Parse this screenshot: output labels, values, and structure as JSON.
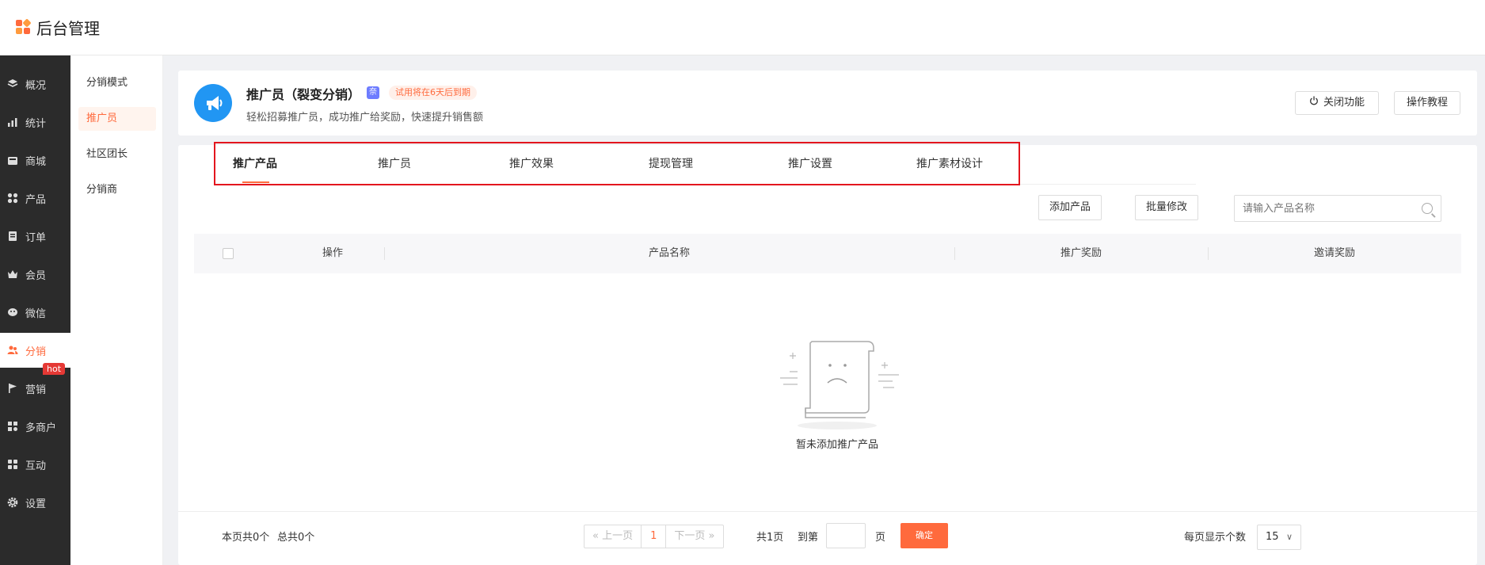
{
  "app": {
    "title": "后台管理"
  },
  "nav": {
    "items": [
      {
        "label": "概况",
        "icon": "layers-icon"
      },
      {
        "label": "统计",
        "icon": "chart-icon"
      },
      {
        "label": "商城",
        "icon": "shop-icon"
      },
      {
        "label": "产品",
        "icon": "grid-icon"
      },
      {
        "label": "订单",
        "icon": "order-icon"
      },
      {
        "label": "会员",
        "icon": "crown-icon"
      },
      {
        "label": "微信",
        "icon": "wechat-icon"
      },
      {
        "label": "分销",
        "icon": "users-icon",
        "active": true
      },
      {
        "label": "营销",
        "icon": "flag-icon",
        "badge": "hot"
      },
      {
        "label": "多商户",
        "icon": "store-icon"
      },
      {
        "label": "互动",
        "icon": "interact-icon"
      },
      {
        "label": "设置",
        "icon": "gear-icon"
      }
    ]
  },
  "subnav": {
    "items": [
      "分销模式",
      "推广员",
      "社区团长",
      "分销商"
    ],
    "active": "推广员"
  },
  "header": {
    "title": "推广员（裂变分销）",
    "badge": "奈",
    "trial": "试用将在6天后到期",
    "desc": "轻松招募推广员，成功推广给奖励，快速提升销售额",
    "close_label": "关闭功能",
    "tutorial_label": "操作教程"
  },
  "tabs": [
    "推广产品",
    "推广员",
    "推广效果",
    "提现管理",
    "推广设置",
    "推广素材设计"
  ],
  "toolbar": {
    "add_label": "添加产品",
    "batch_label": "批量修改",
    "search_placeholder": "请输入产品名称"
  },
  "table": {
    "columns": [
      "操作",
      "产品名称",
      "推广奖励",
      "邀请奖励"
    ],
    "empty_text": "暂未添加推广产品"
  },
  "pagination": {
    "page_count_text": "本页共0个",
    "total_text": "总共0个",
    "prev": "上一页",
    "current": "1",
    "next": "下一页",
    "total_pages": "共1页",
    "goto": "到第",
    "page_unit": "页",
    "confirm": "确定",
    "per_page_label": "每页显示个数",
    "per_page": "15"
  },
  "colors": {
    "accent": "#ff6a3d",
    "nav_bg": "#2b2b2b",
    "highlight": "#e3161e",
    "icon_blue": "#2196f3"
  }
}
